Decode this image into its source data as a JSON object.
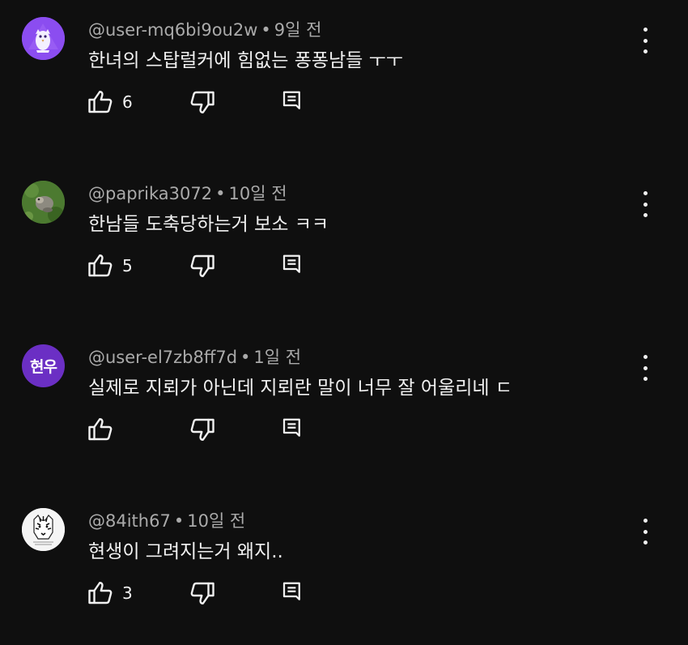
{
  "separator": "•",
  "comments": [
    {
      "author": "@user-mq6bi9ou2w",
      "time": "9일 전",
      "text": "한녀의 스탑럴커에 힘없는 퐁퐁남들 ㅜㅜ",
      "likes": "6",
      "avatar": "owl-avatar"
    },
    {
      "author": "@paprika3072",
      "time": "10일 전",
      "text": "한남들 도축당하는거 보소 ㅋㅋ",
      "likes": "5",
      "avatar": "animal-photo-avatar"
    },
    {
      "author": "@user-el7zb8ff7d",
      "time": "1일 전",
      "text": "실제로 지뢰가 아닌데 지뢰란 말이 너무 잘 어울리네 ㄷ",
      "likes": "",
      "avatar": "initials-avatar",
      "avatar_text": "현우",
      "avatar_color": "#6b2fc4"
    },
    {
      "author": "@84ith67",
      "time": "10일 전",
      "text": "현생이 그려지는거 왜지..",
      "likes": "3",
      "avatar": "tiger-avatar"
    }
  ]
}
